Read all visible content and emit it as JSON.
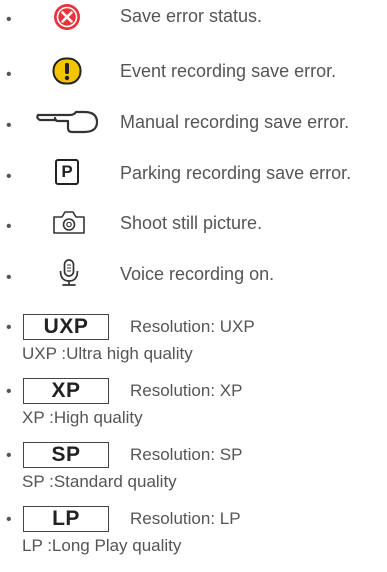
{
  "bullet": "•",
  "items": [
    {
      "icon": "error-circle-icon",
      "label": "Save error status."
    },
    {
      "icon": "exclamation-icon",
      "label": "Event recording save error."
    },
    {
      "icon": "pointing-hand-icon",
      "label": "Manual recording save error."
    },
    {
      "icon": "parking-p-icon",
      "icon_text": "P",
      "label": "Parking recording save error."
    },
    {
      "icon": "camera-icon",
      "label": "Shoot still picture."
    },
    {
      "icon": "microphone-icon",
      "label": "Voice recording on."
    }
  ],
  "resolutions": [
    {
      "badge": "UXP",
      "label": "Resolution: UXP",
      "desc": "UXP :Ultra high quality"
    },
    {
      "badge": "XP",
      "label": "Resolution: XP",
      "desc": "XP :High quality"
    },
    {
      "badge": "SP",
      "label": "Resolution: SP",
      "desc": "SP :Standard quality"
    },
    {
      "badge": "LP",
      "label": "Resolution: LP",
      "desc": "LP :Long Play quality"
    }
  ],
  "colors": {
    "error_red": "#e8333a",
    "warning_yellow": "#f5c400",
    "text": "#555555",
    "icon_stroke": "#333333"
  }
}
